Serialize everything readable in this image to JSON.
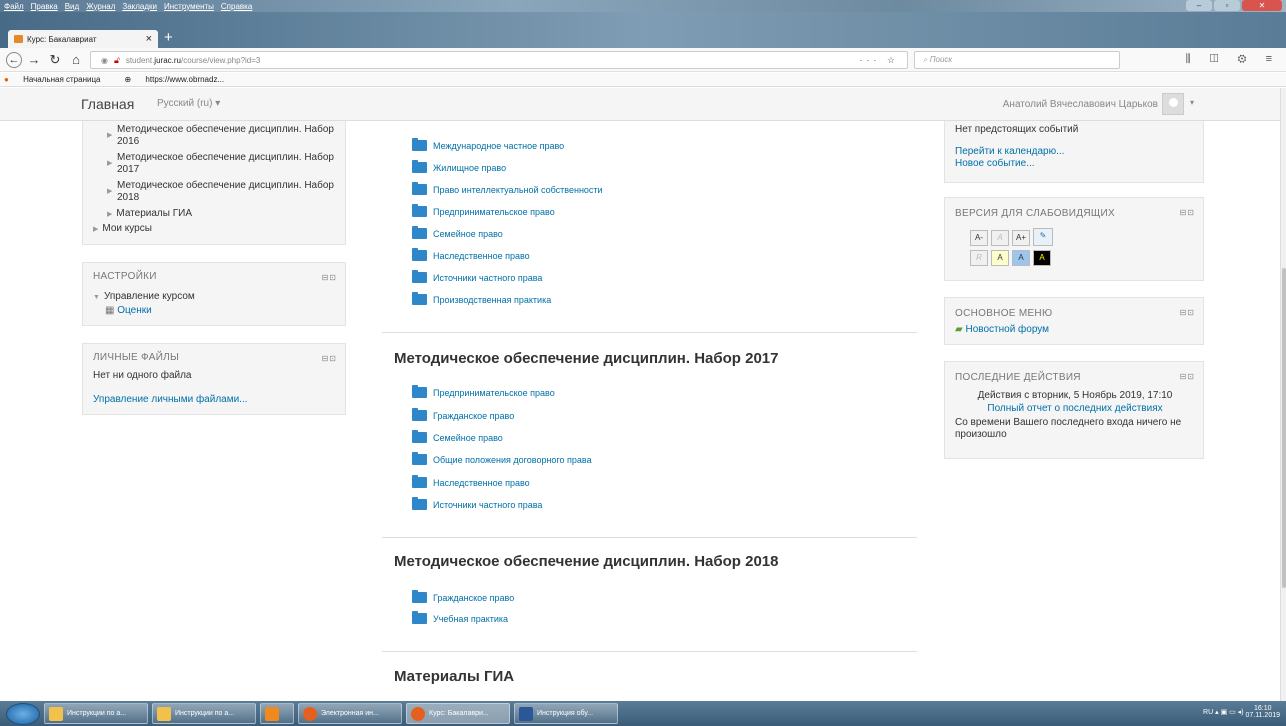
{
  "menu": [
    "Файл",
    "Правка",
    "Вид",
    "Журнал",
    "Закладки",
    "Инструменты",
    "Справка"
  ],
  "tab": {
    "title": "Курс: Бакалавриат",
    "close": "×",
    "new": "+"
  },
  "nav": {
    "url_host": "student.",
    "url_domain": "jurac.ru",
    "url_path": "/course/view.php?id=3",
    "page_actions": "··· ☆",
    "search_placeholder": "Поиск",
    "right_icons": "⫼ ◫ ⚙ ≡"
  },
  "bookmarks": {
    "item1": "Начальная страница",
    "item2": "https://www.obrnadz..."
  },
  "header": {
    "site": "Главная",
    "lang": "Русский (ru) ▾",
    "user": "Анатолий Вячеславович Царьков",
    "caret": "▾"
  },
  "left": {
    "nav_items": [
      "Методическое обеспечение дисциплин. Набор 2016",
      "Методическое обеспечение дисциплин. Набор 2017",
      "Методическое обеспечение дисциплин. Набор 2018",
      "Материалы ГИА"
    ],
    "my_courses": "Мои курсы",
    "settings_title": "НАСТРОЙКИ",
    "settings_item": "Управление курсом",
    "settings_sub": "Оценки",
    "files_title": "ЛИЧНЫЕ ФАЙЛЫ",
    "files_empty": "Нет ни одного файла",
    "files_link": "Управление личными файлами..."
  },
  "main": {
    "top_items": [
      "Международное частное право",
      "Жилищное право",
      "Право интеллектуальной собственности",
      "Предпринимательское право",
      "Семейное право",
      "Наследственное право",
      "Источники частного права",
      "Производственная практика"
    ],
    "s2017_title": "Методическое обеспечение дисциплин. Набор 2017",
    "s2017_items": [
      "Предпринимательское право",
      "Гражданское право",
      "Семейное право",
      "Общие положения договорного права",
      "Наследственное право",
      "Источники частного права"
    ],
    "s2018_title": "Методическое обеспечение дисциплин. Набор 2018",
    "s2018_items": [
      "Гражданское право",
      "Учебная практика"
    ],
    "gia_title": "Материалы ГИА"
  },
  "right": {
    "events_empty": "Нет предстоящих событий",
    "goto_calendar": "Перейти к календарю...",
    "new_event": "Новое событие...",
    "access_title": "ВЕРСИЯ ДЛЯ СЛАБОВИДЯЩИХ",
    "access_row1": [
      "A-",
      "A",
      "A+"
    ],
    "access_row2": [
      "R",
      "A",
      "A",
      "A"
    ],
    "mainmenu_title": "ОСНОВНОЕ МЕНЮ",
    "forum": "Новостной форум",
    "recent_title": "ПОСЛЕДНИЕ ДЕЙСТВИЯ",
    "recent_since": "Действия с вторник, 5 Ноябрь 2019, 17:10",
    "recent_report": "Полный отчет о последних действиях",
    "recent_none": "Со времени Вашего последнего входа ничего не произошло"
  },
  "taskbar": {
    "buttons": [
      "Инструкции по а...",
      "Инструкции по а...",
      "",
      "Электронная ин...",
      "Курс: Бакалаври...",
      "Инструкция обу..."
    ],
    "lang": "RU",
    "time": "16:10",
    "date": "07.11.2019"
  },
  "colors": {
    "link": "#0070a8",
    "folder": "#2d87c8",
    "block_bg": "#f5f5f5"
  }
}
